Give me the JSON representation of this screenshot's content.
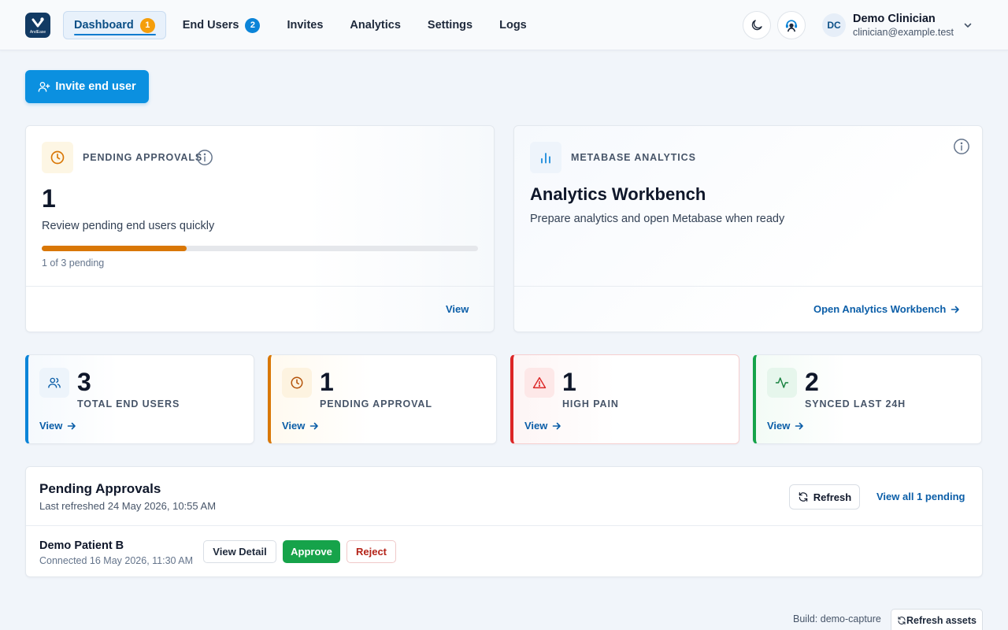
{
  "header": {
    "logo_text": "AndEase",
    "nav": [
      {
        "label": "Dashboard",
        "badge": "1",
        "active": true
      },
      {
        "label": "End Users",
        "badge": "2"
      },
      {
        "label": "Invites"
      },
      {
        "label": "Analytics"
      },
      {
        "label": "Settings"
      },
      {
        "label": "Logs"
      }
    ],
    "theme_toggle_icon": "moon-icon",
    "support_icon": "support-agent-icon",
    "user": {
      "initials": "DC",
      "name": "Demo Clinician",
      "email": "clinician@example.test"
    }
  },
  "actions": {
    "invite_label": "Invite end user"
  },
  "pending_card": {
    "eyebrow": "PENDING APPROVALS",
    "value": "1",
    "subtitle": "Review pending end users quickly",
    "progress_fraction": 0.333,
    "progress_caption": "1 of 3 pending",
    "link": "View"
  },
  "analytics_card": {
    "eyebrow": "METABASE ANALYTICS",
    "title": "Analytics Workbench",
    "subtitle": "Prepare analytics and open Metabase when ready",
    "link": "Open Analytics Workbench"
  },
  "stats": [
    {
      "value": "3",
      "label": "TOTAL END USERS",
      "link": "View",
      "icon": "users-icon",
      "color": "#0b84d8"
    },
    {
      "value": "1",
      "label": "PENDING APPROVAL",
      "link": "View",
      "icon": "clock-icon",
      "color": "#d97706"
    },
    {
      "value": "1",
      "label": "HIGH PAIN",
      "link": "View",
      "icon": "warning-triangle-icon",
      "color": "#dc2626"
    },
    {
      "value": "2",
      "label": "SYNCED LAST 24H",
      "link": "View",
      "icon": "activity-pulse-icon",
      "color": "#16a34a"
    }
  ],
  "pending_panel": {
    "title": "Pending Approvals",
    "last_refreshed": "Last refreshed 24 May 2026, 10:55 AM",
    "refresh_label": "Refresh",
    "view_all": "View all 1 pending",
    "rows": [
      {
        "name": "Demo Patient B",
        "connected": "Connected 16 May 2026, 11:30 AM",
        "view_detail": "View Detail",
        "approve": "Approve",
        "reject": "Reject"
      }
    ]
  },
  "footer": {
    "build": "Build: demo-capture",
    "refresh_assets": "Refresh assets"
  },
  "colors": {
    "brand_navy": "#123a63",
    "primary": "#0b90e0",
    "link": "#0b5ea8",
    "pending_orange": "#d97706",
    "danger": "#dc2626",
    "success": "#16a34a"
  }
}
